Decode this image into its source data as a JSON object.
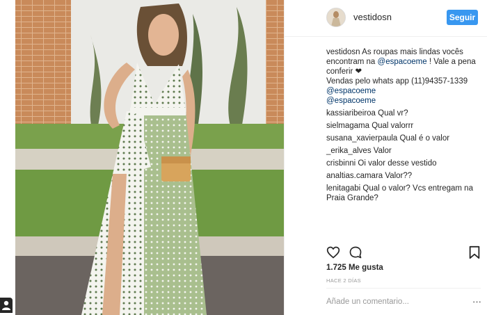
{
  "post": {
    "username": "vestidosn",
    "follow_label": "Seguir",
    "caption": {
      "user": "vestidosn",
      "text_1": " As roupas mais lindas vocês encontram na ",
      "mention_1": "@espacoeme",
      "text_2": " ! Vale a pena conferir ❤",
      "line_2": "Vendas pelo whats app (11)94357-1339",
      "mention_2": "@espacoeme",
      "mention_3": "@espacoeme"
    },
    "comments": [
      {
        "user": "kassiaribeiroa",
        "text": " Qual vr?"
      },
      {
        "user": "sielmagama",
        "text": " Qual valorrr"
      },
      {
        "user": "susana_xavierpaula",
        "text": " Qual é o valor"
      },
      {
        "user": "_erika_alves",
        "text": " Valor"
      },
      {
        "user": "crisbinni",
        "text": " Oi valor desse vestido"
      },
      {
        "user": "analtias.camara",
        "text": " Valor??"
      },
      {
        "user": "lenitagabi",
        "text": " Qual o valor? Vcs entregam na Praia Grande?"
      }
    ],
    "likes": "1.725 Me gusta",
    "timestamp": "HACE 2 DÍAS",
    "comment_placeholder": "Añade un comentario...",
    "more": "···"
  },
  "icons": {
    "like": "heart-icon",
    "comment": "speech-bubble-icon",
    "save": "bookmark-icon",
    "person": "person-icon"
  },
  "colors": {
    "follow_button": "#3897f0",
    "mention": "#003569",
    "muted": "#999999",
    "text": "#262626"
  }
}
